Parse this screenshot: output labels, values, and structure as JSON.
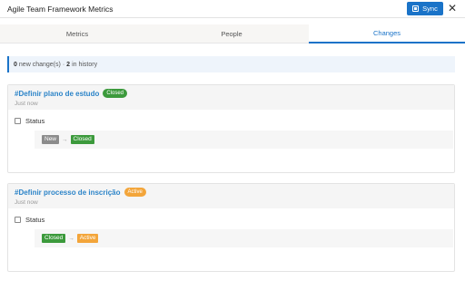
{
  "window": {
    "title": "Agile Team Framework Metrics",
    "sync_label": "Sync",
    "sync_icon": "sync-icon",
    "close_glyph": "✕"
  },
  "tabs": [
    {
      "label": "Metrics",
      "active": false
    },
    {
      "label": "People",
      "active": false
    },
    {
      "label": "Changes",
      "active": true
    }
  ],
  "summary": {
    "new_count": "0",
    "new_label": "new change(s)",
    "separator": "·",
    "history_count": "2",
    "history_label": "in history"
  },
  "changes": [
    {
      "title": "#Definir plano de estudo",
      "status_badge": "Closed",
      "time": "Just now",
      "field": "Status",
      "from": "New",
      "arrow": "→",
      "to": "Closed"
    },
    {
      "title": "#Definir processo de inscrição",
      "status_badge": "Active",
      "time": "Just now",
      "field": "Status",
      "from": "Closed",
      "arrow": "→",
      "to": "Active"
    }
  ],
  "colors": {
    "accent": "#1a73c8",
    "closed": "#3c9a3c",
    "active": "#f3a53a",
    "new": "#8c8c8c"
  }
}
